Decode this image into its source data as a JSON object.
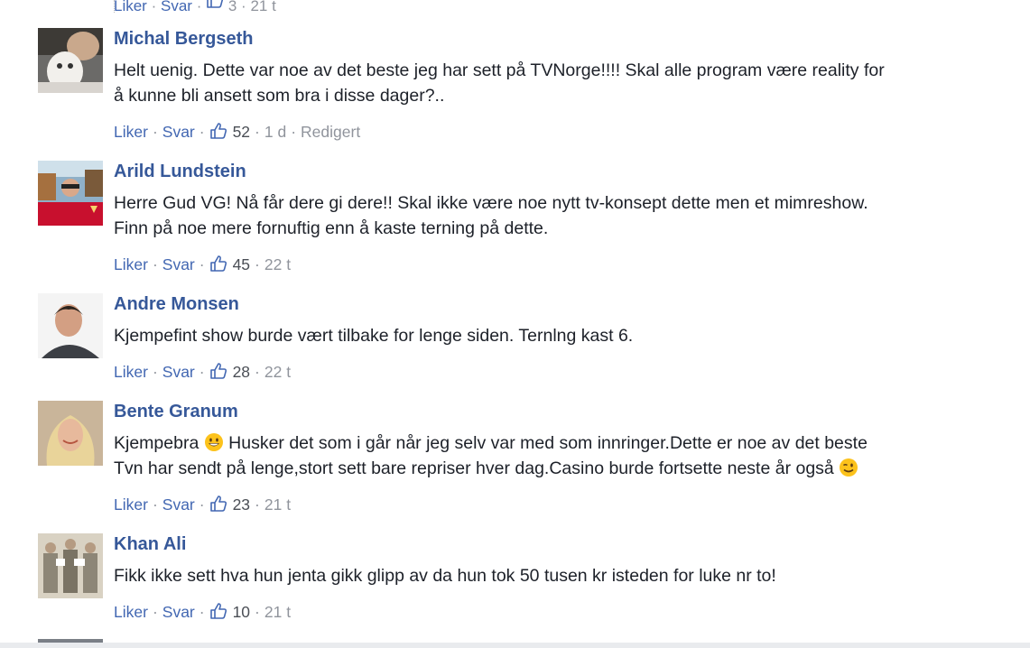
{
  "previous_comment": {
    "like_label": "Liker",
    "reply_label": "Svar",
    "likes": "3",
    "time": "21 t"
  },
  "comments": [
    {
      "author": "Michal Bergseth",
      "lines": [
        "Helt uenig. Dette var noe av det beste jeg har sett på TVNorge!!!! Skal alle program være reality for",
        "å kunne bli ansett som bra i disse dager?.."
      ],
      "like_label": "Liker",
      "reply_label": "Svar",
      "likes": "52",
      "time": "1 d",
      "edited": "Redigert"
    },
    {
      "author": "Arild Lundstein",
      "lines": [
        "Herre Gud VG! Nå får dere gi dere!! Skal ikke være noe nytt tv-konsept dette men et mimreshow.",
        "Finn på noe mere fornuftig enn å kaste terning på dette."
      ],
      "like_label": "Liker",
      "reply_label": "Svar",
      "likes": "45",
      "time": "22 t"
    },
    {
      "author": "Andre Monsen",
      "lines": [
        "Kjempefint show burde vært tilbake for lenge siden. Ternlng kast 6."
      ],
      "like_label": "Liker",
      "reply_label": "Svar",
      "likes": "28",
      "time": "22 t"
    },
    {
      "author": "Bente Granum",
      "line1_a": "Kjempebra",
      "line1_b": "Husker det som i går når jeg selv var med som innringer.Dette er noe av det beste",
      "line2": "Tvn har sendt på lenge,stort sett bare repriser hver dag.Casino burde fortsette neste år også",
      "like_label": "Liker",
      "reply_label": "Svar",
      "likes": "23",
      "time": "21 t"
    },
    {
      "author": "Khan Ali",
      "lines": [
        "Fikk ikke sett hva hun jenta gikk glipp av da hun tok 50 tusen kr isteden for luke nr to!"
      ],
      "like_label": "Liker",
      "reply_label": "Svar",
      "likes": "10",
      "time": "21 t"
    }
  ],
  "separator": "·"
}
